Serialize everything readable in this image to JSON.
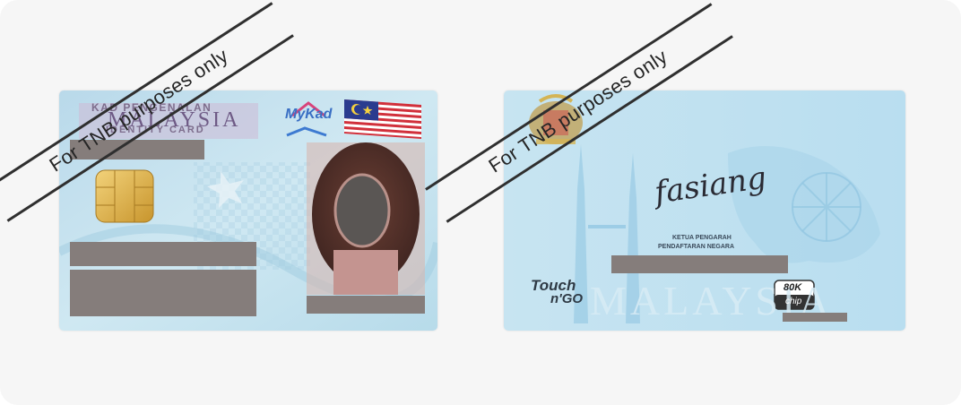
{
  "watermark_text": "For TNB purposes only",
  "front": {
    "title_line1": "KAD PENGENALAN",
    "title_line2": "MALAYSIA",
    "title_line3": "IDENTITY CARD",
    "brand": "MyKad"
  },
  "back": {
    "signature": "fasiang",
    "signatory_line1": "KETUA PENGARAH",
    "signatory_line2": "PENDAFTARAN NEGARA",
    "country_text": "MALAYSIA",
    "touch_line1": "Touch",
    "touch_line2": "n'GO",
    "chip_capacity": "80K",
    "chip_label": "chip"
  },
  "colors": {
    "card_blue": "#bfe0ee",
    "redaction": "#857d7b",
    "watermark": "#262626",
    "panel_bg": "#f6f6f6"
  }
}
